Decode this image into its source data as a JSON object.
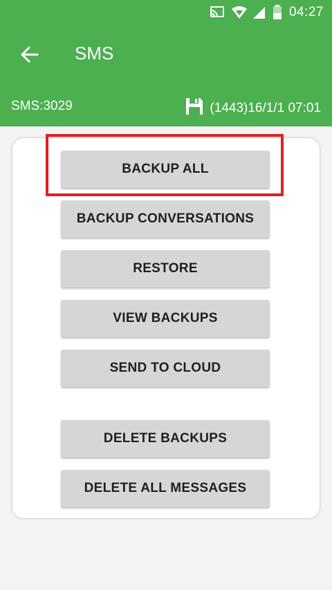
{
  "status": {
    "time": "04:27"
  },
  "toolbar": {
    "title": "SMS"
  },
  "info": {
    "count": "SMS:3029",
    "last_backup": "(1443)16/1/1 07:01"
  },
  "buttons": [
    "BACKUP ALL",
    "BACKUP CONVERSATIONS",
    "RESTORE",
    "VIEW BACKUPS",
    "SEND TO CLOUD",
    "DELETE BACKUPS",
    "DELETE ALL MESSAGES"
  ],
  "colors": {
    "header": "#4caf50",
    "highlight": "#e02020",
    "button": "#d6d6d6"
  }
}
